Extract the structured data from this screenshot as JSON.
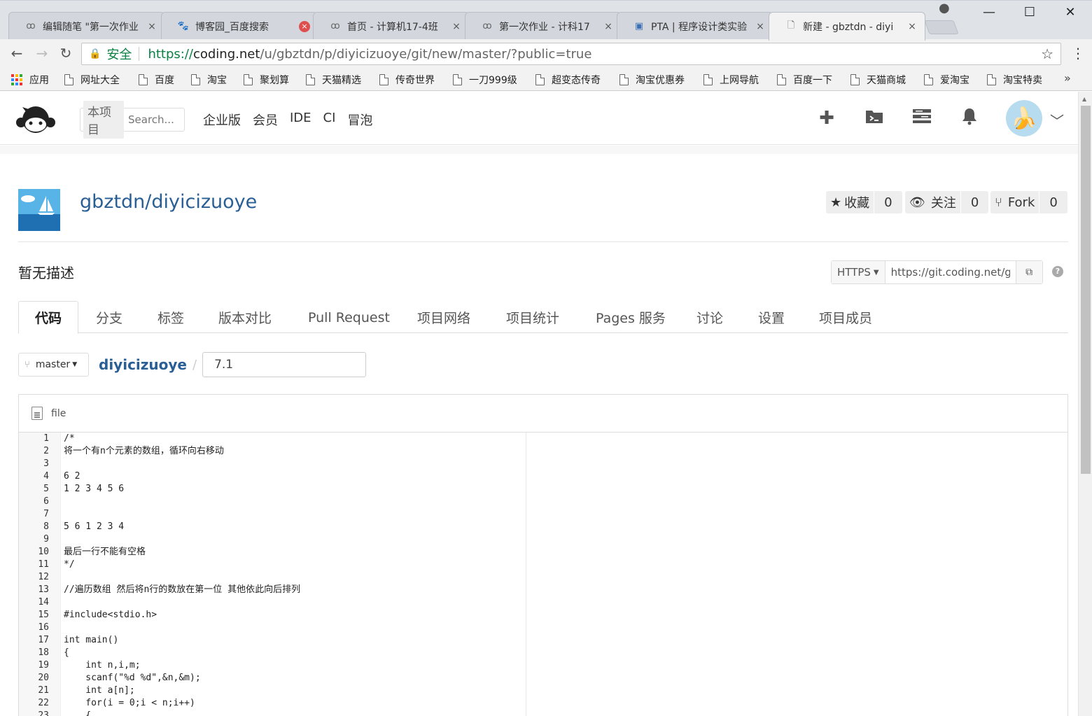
{
  "browser": {
    "tabs": [
      {
        "title": "编辑随笔 \"第一次作业",
        "icon": "cnblogs-icon",
        "close": "×"
      },
      {
        "title": "博客园_百度搜索",
        "icon": "baidu-paw-icon",
        "close": "×"
      },
      {
        "title": "首页 - 计算机17-4班",
        "icon": "cnblogs-icon",
        "close": "×"
      },
      {
        "title": "第一次作业 - 计科17",
        "icon": "cnblogs-icon",
        "close": "×"
      },
      {
        "title": "PTA | 程序设计类实验",
        "icon": "pta-icon",
        "close": "×"
      },
      {
        "title": "新建 - gbztdn - diyi",
        "icon": "page-icon",
        "close": "×"
      }
    ],
    "window_controls": {
      "minimize": "—",
      "maximize": "☐",
      "close": "✕"
    },
    "secure_label": "安全",
    "url": {
      "proto": "https://",
      "host": "coding.net",
      "path": "/u/gbztdn/p/diyicizuoye/git/new/master/?public=true"
    },
    "bookmarks": [
      "应用",
      "网址大全",
      "百度",
      "淘宝",
      "聚划算",
      "天猫精选",
      "传奇世界",
      "一刀999级",
      "超变态传奇",
      "淘宝优惠券",
      "上网导航",
      "百度一下",
      "天猫商城",
      "爱淘宝",
      "淘宝特卖"
    ],
    "bookmarks_more": "»"
  },
  "site": {
    "search_scope": "本项目",
    "search_placeholder": "Search...",
    "nav": [
      "企业版",
      "会员",
      "IDE",
      "CI",
      "冒泡"
    ]
  },
  "repo": {
    "title": "gbztdn/diyicizuoye",
    "star_label": "收藏",
    "star_count": "0",
    "watch_label": "关注",
    "watch_count": "0",
    "fork_label": "Fork",
    "fork_count": "0",
    "description": "暂无描述",
    "clone_protocol": "HTTPS",
    "clone_url": "https://git.coding.net/gbztdn/diyicizuoye.git",
    "tabs": [
      "代码",
      "分支",
      "标签",
      "版本对比",
      "Pull Request",
      "项目网络",
      "项目统计",
      "Pages 服务",
      "讨论",
      "设置",
      "项目成员"
    ],
    "active_tab": "代码"
  },
  "editor": {
    "branch": "master",
    "repo_link": "diyicizuoye",
    "path_separator": "/",
    "filename": "7.1",
    "header_label": "file",
    "code_lines": [
      "/*",
      "将一个有n个元素的数组，循环向右移动",
      "",
      "6 2",
      "1 2 3 4 5 6",
      "",
      "",
      "5 6 1 2 3 4",
      "",
      "最后一行不能有空格",
      "*/",
      "",
      "//遍历数组 然后将n行的数放在第一位 其他依此向后排列",
      "",
      "#include<stdio.h>",
      "",
      "int main()",
      "{",
      "    int n,i,m;",
      "    scanf(\"%d %d\",&n,&m);",
      "    int a[n];",
      "    for(i = 0;i < n;i++)",
      "    {"
    ]
  }
}
